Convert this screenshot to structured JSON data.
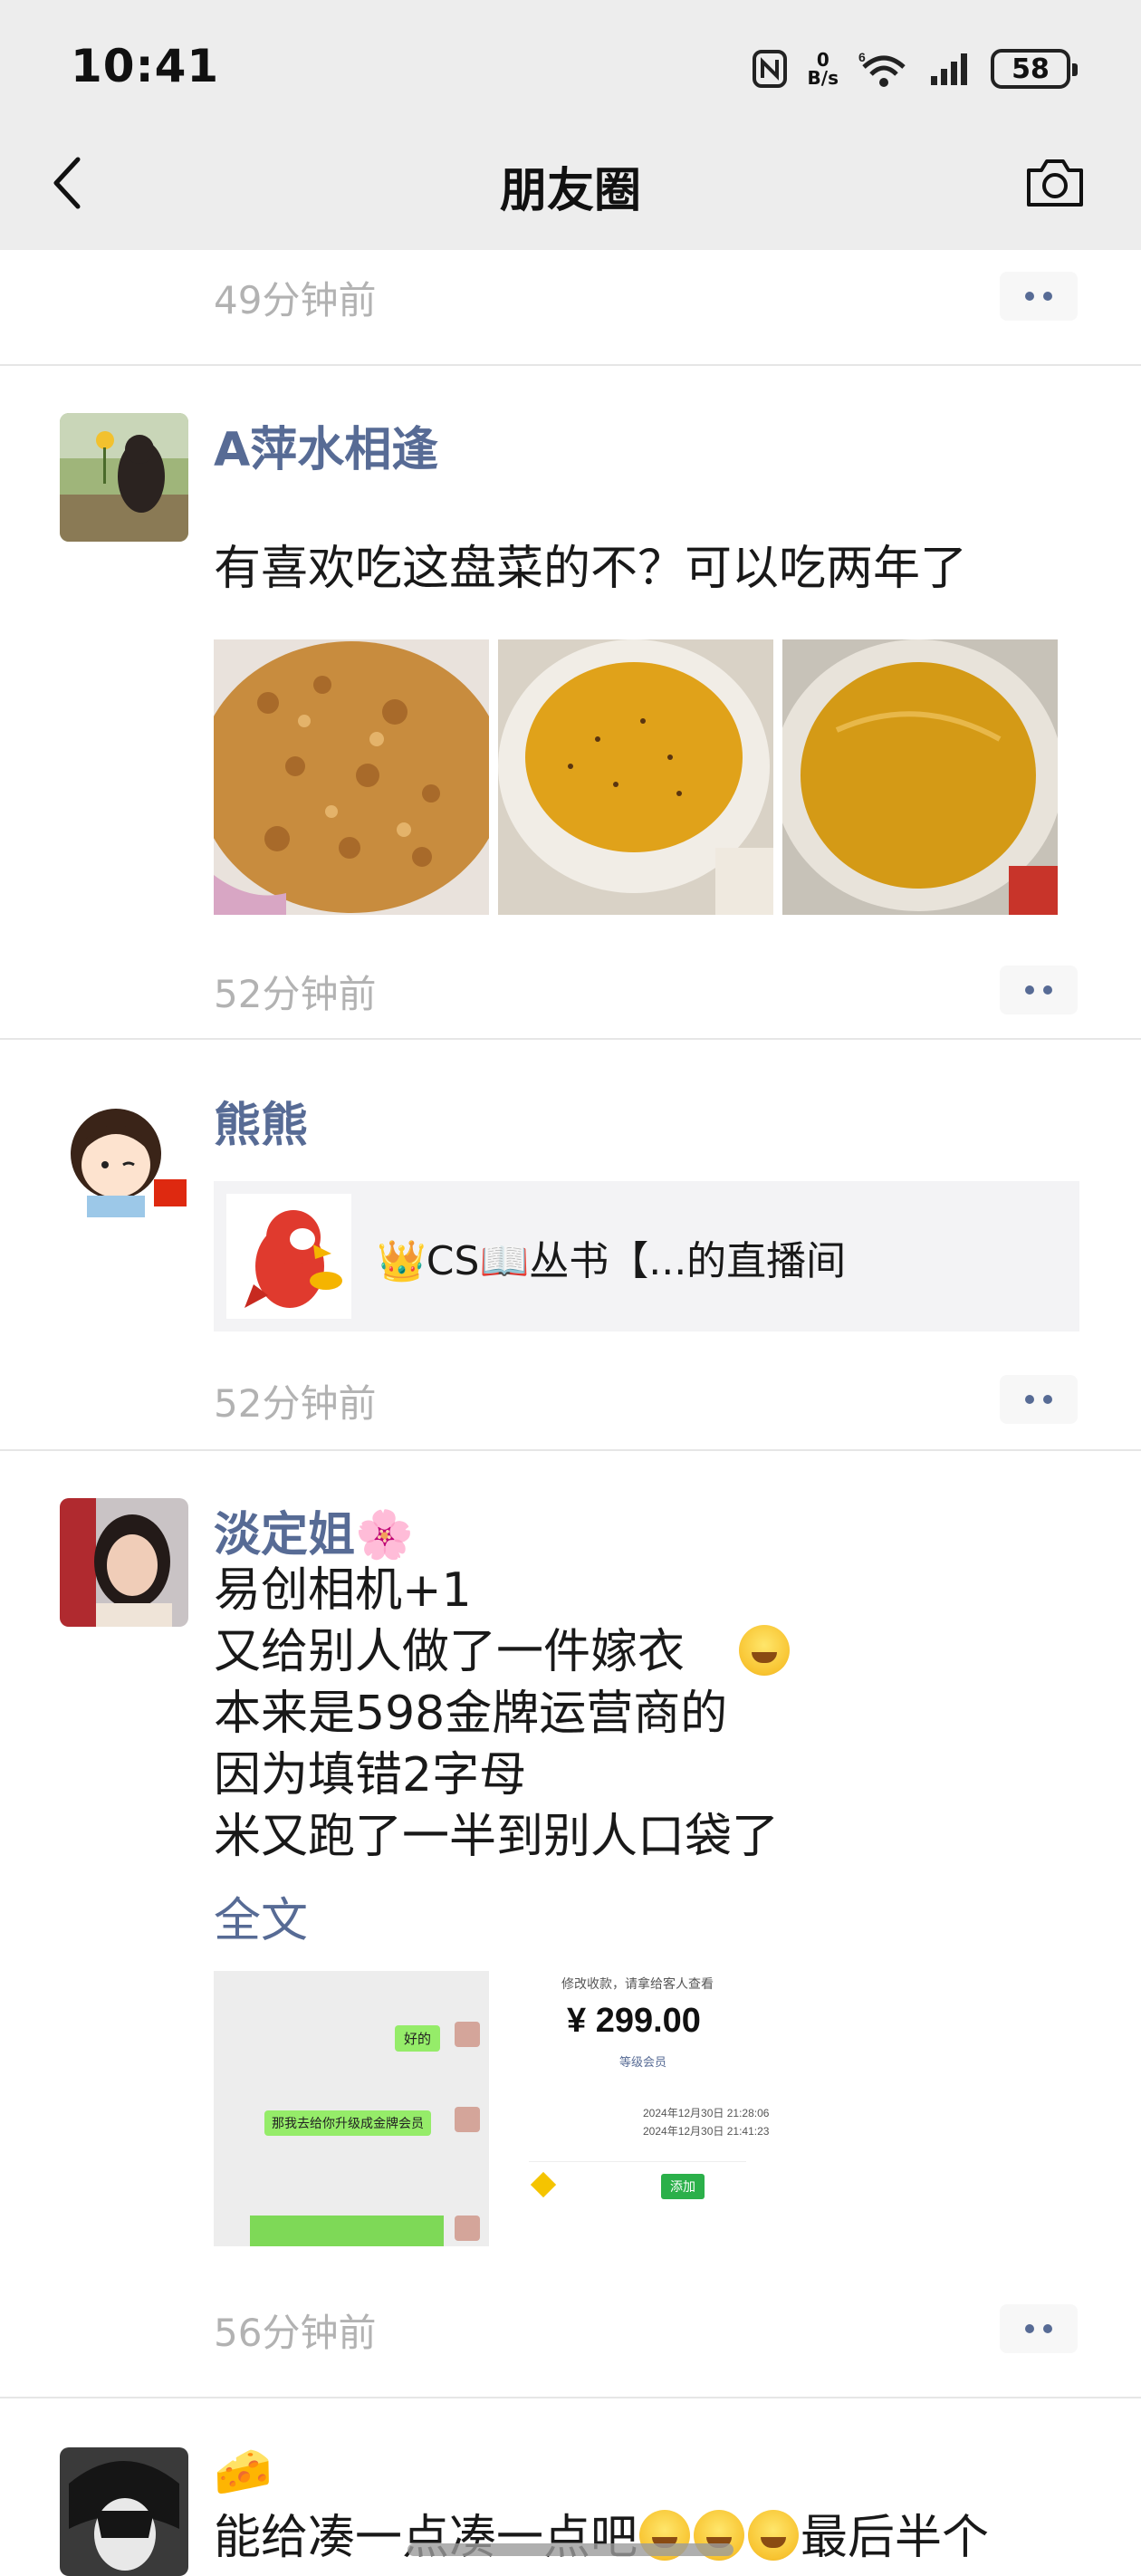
{
  "status_bar": {
    "time": "10:41",
    "net_speed_top": "0",
    "net_speed_bottom": "B/s",
    "signal_label": "6",
    "battery": "58"
  },
  "nav": {
    "title": "朋友圈",
    "back_icon": "chevron-left-icon",
    "camera_icon": "camera-icon"
  },
  "posts": [
    {
      "time": "49分钟前"
    },
    {
      "name": "A萍水相逢",
      "text": "有喜欢吃这盘菜的不？可以吃两年了",
      "time": "52分钟前"
    },
    {
      "name": "熊熊",
      "link_text": "👑CS📖丛书【...的直播间",
      "time": "52分钟前"
    },
    {
      "name": "淡定姐🌸",
      "text": "易创相机+1\n又给别人做了一件嫁衣\n本来是598金牌运营商的\n因为填错2字母\n米又跑了一半到别人口袋了",
      "full_text_label": "全文",
      "screenshot_chat": {
        "bubble1": "好的",
        "bubble2": "那我去给你升级成金牌会员"
      },
      "screenshot_pay": {
        "title": "修改收款，请拿给客人查看",
        "amount": "¥ 299.00",
        "plan": "等级会员",
        "row1": "2024年12月30日 21:28:06",
        "row2": "2024年12月30日 21:41:23",
        "badge": "添加"
      },
      "time": "56分钟前"
    },
    {
      "name": "🧀",
      "text": "能给凑一点凑一点吧",
      "text_tail": "最后半个"
    }
  ]
}
